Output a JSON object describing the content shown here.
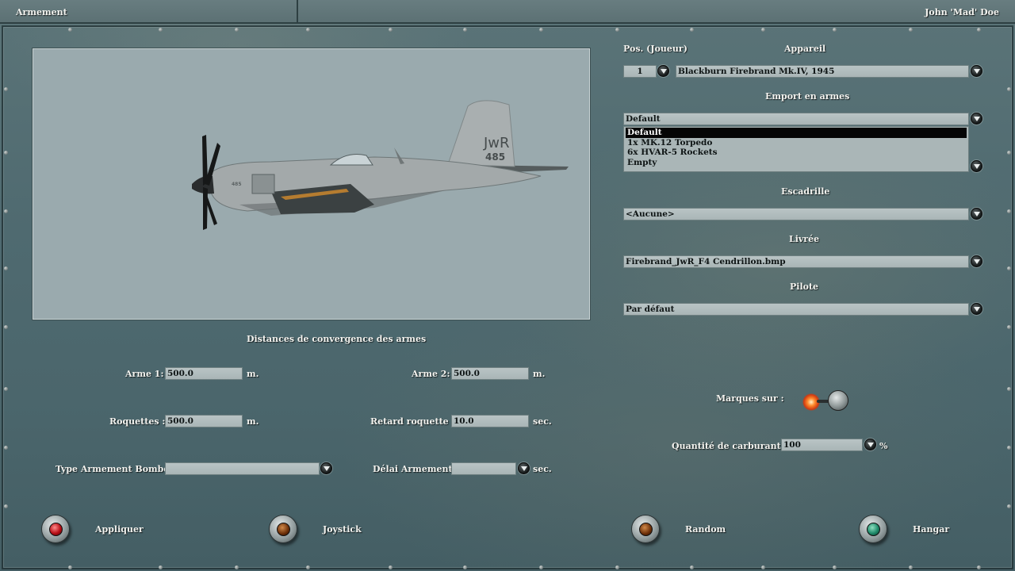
{
  "window": {
    "title": "Armement",
    "user": "John 'Mad' Doe"
  },
  "aircraft_panel": {
    "pos_label": "Pos. (Joueur)",
    "pos_value": "1",
    "appareil_label": "Appareil",
    "appareil_value": "Blackburn Firebrand Mk.IV, 1945",
    "emport_label": "Emport en armes",
    "emport_value": "Default",
    "emport_options": [
      "Default",
      "1x MK.12 Torpedo",
      "6x HVAR-5 Rockets",
      "Empty"
    ],
    "escadrille_label": "Escadrille",
    "escadrille_value": "<Aucune>",
    "livree_label": "Livrée",
    "livree_value": "Firebrand_JwR_F4 Cendrillon.bmp",
    "pilote_label": "Pilote",
    "pilote_value": "Par défaut"
  },
  "preview": {
    "tail_code": "JwR",
    "tail_number": "485",
    "fuselage_number": "485"
  },
  "convergence": {
    "heading": "Distances de convergence des armes",
    "arme1_label": "Arme 1:",
    "arme1_value": "500.0",
    "arme1_unit": "m.",
    "arme2_label": "Arme 2:",
    "arme2_value": "500.0",
    "arme2_unit": "m.",
    "roquettes_label": "Roquettes :",
    "roquettes_value": "500.0",
    "roquettes_unit": "m.",
    "retard_label": "Retard roquette :",
    "retard_value": "10.0",
    "retard_unit": "sec.",
    "type_bombe_label": "Type Armement Bombe:",
    "type_bombe_value": "",
    "delai_label": "Délai Armement:",
    "delai_value": "",
    "delai_unit": "sec."
  },
  "options": {
    "marques_label": "Marques sur :",
    "marques_on": true,
    "carburant_label": "Quantité de carburant :",
    "carburant_value": "100",
    "carburant_unit": "%"
  },
  "buttons": {
    "appliquer": "Appliquer",
    "joystick": "Joystick",
    "random": "Random",
    "hangar": "Hangar"
  },
  "colors": {
    "lamp_red": "#b80f16",
    "lamp_amber": "#6a2e08",
    "lamp_green": "#1f8a6a",
    "toggle_glow": "#ff8a2c"
  }
}
